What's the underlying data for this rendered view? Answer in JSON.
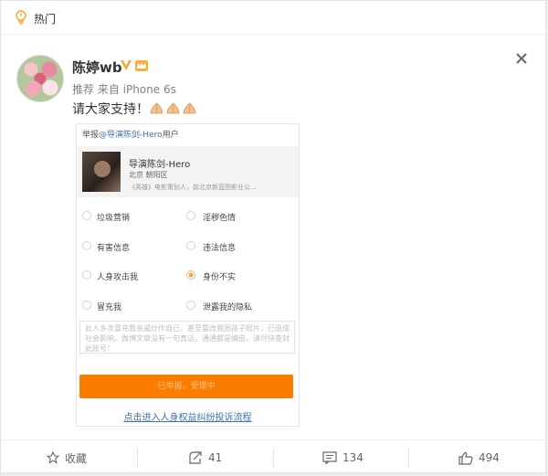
{
  "header": {
    "hot_label": "热门",
    "icon": "hot-bulb-icon"
  },
  "post": {
    "username": "陈婷wb",
    "meta": "推荐 来自 iPhone 6s",
    "text": "请大家支持！",
    "emoji_count": 3,
    "badges": [
      "verified-v-icon",
      "crown-badge-icon"
    ]
  },
  "card": {
    "report_prefix": "举报",
    "report_link": "@导演陈剑-Hero",
    "report_suffix": "用户",
    "target_name": "导演陈剑-Hero",
    "target_location": "北京 朝阳区",
    "target_desc": "《英雄》电影策划人，前北京新蓝图影业公...",
    "options": [
      {
        "label": "垃圾营销",
        "selected": false
      },
      {
        "label": "淫秽色情",
        "selected": false
      },
      {
        "label": "有害信息",
        "selected": false
      },
      {
        "label": "违法信息",
        "selected": false
      },
      {
        "label": "人身攻击我",
        "selected": false
      },
      {
        "label": "身份不实",
        "selected": true
      },
      {
        "label": "冒充我",
        "selected": false
      },
      {
        "label": "泄露我的隐私",
        "selected": false
      }
    ],
    "remark": "此人多次冒充我亲戚炒作自己，甚至篡改我图孩子照片，已造成社会影响，微博文章没有一句真话，通通都是编造，请尽快查封此账号！",
    "submit_label": "已举报，受理中",
    "appeal_link": "点击进入人身权益纠纷投诉流程"
  },
  "actions": {
    "favorite_label": "收藏",
    "repost_count": "41",
    "comment_count": "134",
    "like_count": "494"
  },
  "colors": {
    "accent_orange": "#fa7d00",
    "link_blue": "#3e6fb5"
  }
}
